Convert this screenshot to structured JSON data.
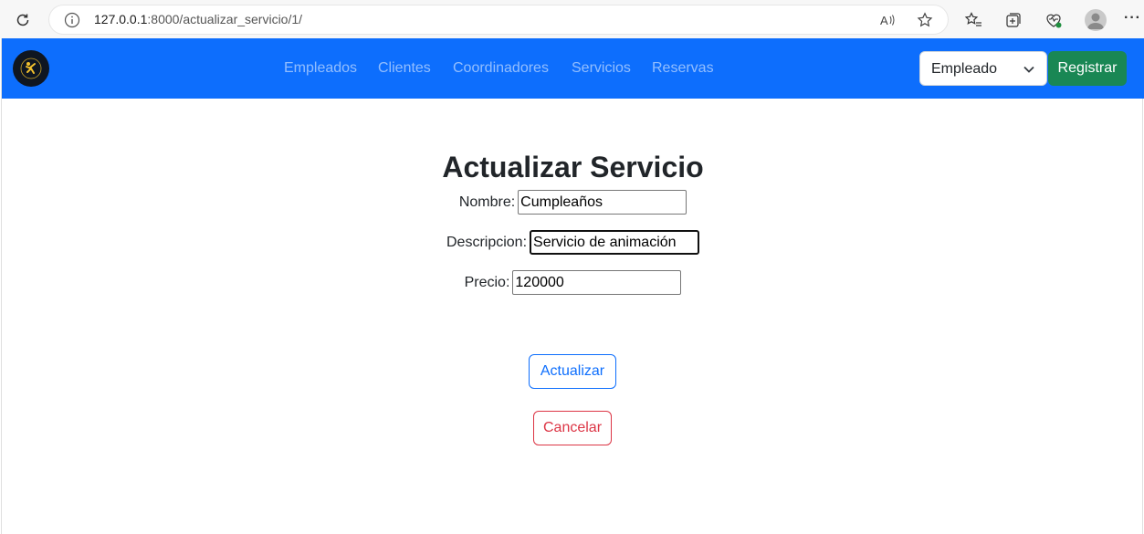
{
  "browser": {
    "url_host": "127.0.0.1",
    "url_rest": ":8000/actualizar_servicio/1/"
  },
  "navbar": {
    "links": [
      "Empleados",
      "Clientes",
      "Coordinadores",
      "Servicios",
      "Reservas"
    ],
    "role_select": {
      "selected": "Empleado"
    },
    "register_label": "Registrar"
  },
  "form": {
    "title": "Actualizar Servicio",
    "nombre_label": "Nombre:",
    "nombre_value": "Cumpleaños",
    "descripcion_label": "Descripcion:",
    "descripcion_value": "Servicio de animación",
    "precio_label": "Precio:",
    "precio_value": "120000",
    "submit_label": "Actualizar",
    "cancel_label": "Cancelar"
  },
  "colors": {
    "navbar": "#0d6efd",
    "register": "#198754",
    "primary": "#0d6efd",
    "danger": "#dc3545"
  }
}
